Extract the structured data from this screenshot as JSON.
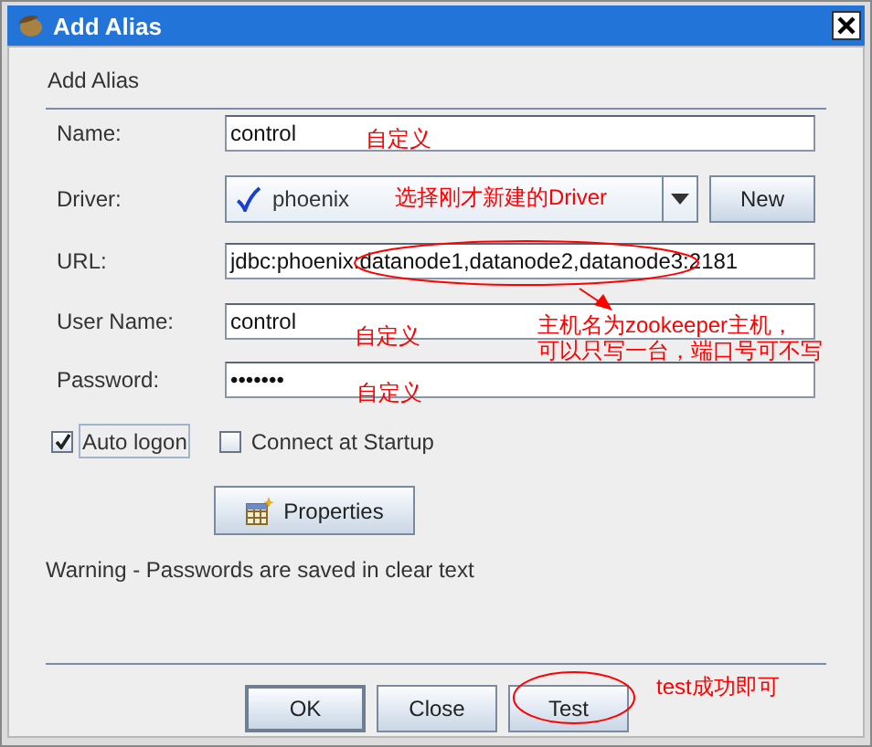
{
  "window": {
    "title": "Add Alias"
  },
  "header": "Add Alias",
  "fields": [
    {
      "kind": "text",
      "label": "Name:",
      "value": "control"
    },
    {
      "kind": "combo",
      "label": "Driver:",
      "value": "phoenix",
      "button": "New"
    },
    {
      "kind": "text",
      "label": "URL:",
      "value": "jdbc:phoenix:datanode1,datanode2,datanode3:2181"
    },
    {
      "kind": "text",
      "label": "User Name:",
      "value": "control"
    },
    {
      "kind": "text",
      "label": "Password:",
      "value": "•••••••"
    }
  ],
  "checkboxes": [
    {
      "label": "Auto logon",
      "checked": true,
      "focused": true
    },
    {
      "label": "Connect at Startup",
      "checked": false,
      "focused": false
    }
  ],
  "properties_button": "Properties",
  "warning": "Warning - Passwords are saved in clear text",
  "buttons": [
    {
      "label": "OK",
      "default": true
    },
    {
      "label": "Close",
      "default": false
    },
    {
      "label": "Test",
      "default": false
    }
  ],
  "annotations": [
    {
      "text": "自定义"
    },
    {
      "text": "选择刚才新建的Driver"
    },
    {
      "text": "自定义"
    },
    {
      "text": "主机名为zookeeper主机，"
    },
    {
      "text": "可以只写一台，端口号可不写"
    },
    {
      "text": "自定义"
    },
    {
      "text": "test成功即可"
    }
  ]
}
